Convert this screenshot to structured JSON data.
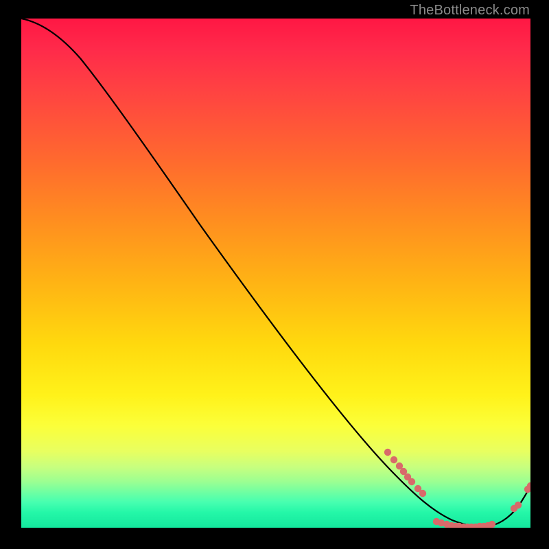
{
  "watermark": "TheBottleneck.com",
  "colors": {
    "background": "#000000",
    "curve_stroke": "#000000",
    "marker_fill": "#d86a6a",
    "watermark": "#8b8b8b",
    "gradient_top": "#ff1744",
    "gradient_bottom": "#14e79d"
  },
  "chart_data": {
    "type": "line",
    "title": "",
    "xlabel": "",
    "ylabel": "",
    "xlim": [
      0,
      100
    ],
    "ylim": [
      0,
      100
    ],
    "grid": false,
    "legend": false,
    "note": "No axis ticks or numeric labels are rendered; values below are read off pixel positions as percentages of each axis.",
    "series": [
      {
        "name": "curve",
        "kind": "line",
        "x": [
          0,
          3,
          6,
          10,
          14,
          18,
          25,
          35,
          45,
          55,
          65,
          72,
          76,
          79,
          82,
          85,
          88,
          91,
          94,
          97,
          100
        ],
        "y": [
          100,
          99,
          97,
          94,
          90,
          85,
          76,
          63,
          50,
          37,
          24,
          15,
          10,
          6,
          3,
          1,
          0,
          0,
          1,
          4,
          8
        ]
      },
      {
        "name": "markers-cluster-1",
        "kind": "scatter",
        "x": [
          72.0,
          73.2,
          74.3,
          75.1,
          75.9,
          76.7,
          77.9,
          78.8
        ],
        "y": [
          14.8,
          13.4,
          12.1,
          11.0,
          10.0,
          9.0,
          7.7,
          6.7
        ]
      },
      {
        "name": "markers-floor",
        "kind": "scatter",
        "x": [
          81.5,
          82.5,
          83.5,
          84.5,
          85.3,
          86.0,
          86.8,
          87.6,
          88.4,
          89.2,
          90.0,
          90.8,
          91.6,
          92.4
        ],
        "y": [
          1.2,
          0.9,
          0.6,
          0.4,
          0.3,
          0.2,
          0.2,
          0.1,
          0.1,
          0.1,
          0.2,
          0.3,
          0.5,
          0.7
        ]
      },
      {
        "name": "markers-cluster-2",
        "kind": "scatter",
        "x": [
          96.8,
          97.6,
          99.5,
          100.0
        ],
        "y": [
          3.8,
          4.5,
          7.5,
          8.2
        ]
      }
    ]
  }
}
